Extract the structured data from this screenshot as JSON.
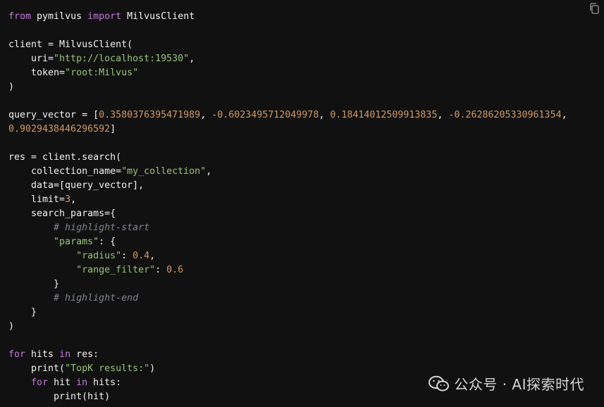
{
  "colors": {
    "background": "#111111",
    "text": "#f2f2f2",
    "keyword": "#c678dd",
    "string": "#98c379",
    "number": "#d19a66",
    "comment": "#7f848e"
  },
  "toolbar": {
    "copy_icon": "copy-icon"
  },
  "watermark": {
    "icon": "wechat-icon",
    "text": "公众号 · AI探索时代"
  },
  "code": {
    "language": "python",
    "lines": [
      [
        {
          "t": "kw",
          "v": "from"
        },
        {
          "t": "plain",
          "v": " pymilvus "
        },
        {
          "t": "kw",
          "v": "import"
        },
        {
          "t": "plain",
          "v": " MilvusClient"
        }
      ],
      [],
      [
        {
          "t": "plain",
          "v": "client = MilvusClient("
        }
      ],
      [
        {
          "t": "plain",
          "v": "    uri="
        },
        {
          "t": "str",
          "v": "\"http://localhost:19530\""
        },
        {
          "t": "plain",
          "v": ","
        }
      ],
      [
        {
          "t": "plain",
          "v": "    token="
        },
        {
          "t": "str",
          "v": "\"root:Milvus\""
        }
      ],
      [
        {
          "t": "plain",
          "v": ")"
        }
      ],
      [],
      [
        {
          "t": "plain",
          "v": "query_vector = ["
        },
        {
          "t": "num",
          "v": "0.3580376395471989"
        },
        {
          "t": "plain",
          "v": ", "
        },
        {
          "t": "num",
          "v": "-0.6023495712049978"
        },
        {
          "t": "plain",
          "v": ", "
        },
        {
          "t": "num",
          "v": "0.18414012509913835"
        },
        {
          "t": "plain",
          "v": ", "
        },
        {
          "t": "num",
          "v": "-0.26286205330961354"
        },
        {
          "t": "plain",
          "v": ","
        }
      ],
      [
        {
          "t": "num",
          "v": "0.9029438446296592"
        },
        {
          "t": "plain",
          "v": "]"
        }
      ],
      [],
      [
        {
          "t": "plain",
          "v": "res = client.search("
        }
      ],
      [
        {
          "t": "plain",
          "v": "    collection_name="
        },
        {
          "t": "str",
          "v": "\"my_collection\""
        },
        {
          "t": "plain",
          "v": ","
        }
      ],
      [
        {
          "t": "plain",
          "v": "    data=[query_vector],"
        }
      ],
      [
        {
          "t": "plain",
          "v": "    limit="
        },
        {
          "t": "num",
          "v": "3"
        },
        {
          "t": "plain",
          "v": ","
        }
      ],
      [
        {
          "t": "plain",
          "v": "    search_params={"
        }
      ],
      [
        {
          "t": "cmt",
          "v": "        # highlight-start"
        }
      ],
      [
        {
          "t": "plain",
          "v": "        "
        },
        {
          "t": "str",
          "v": "\"params\""
        },
        {
          "t": "plain",
          "v": ": {"
        }
      ],
      [
        {
          "t": "plain",
          "v": "            "
        },
        {
          "t": "str",
          "v": "\"radius\""
        },
        {
          "t": "plain",
          "v": ": "
        },
        {
          "t": "num",
          "v": "0.4"
        },
        {
          "t": "plain",
          "v": ","
        }
      ],
      [
        {
          "t": "plain",
          "v": "            "
        },
        {
          "t": "str",
          "v": "\"range_filter\""
        },
        {
          "t": "plain",
          "v": ": "
        },
        {
          "t": "num",
          "v": "0.6"
        }
      ],
      [
        {
          "t": "plain",
          "v": "        }"
        }
      ],
      [
        {
          "t": "cmt",
          "v": "        # highlight-end"
        }
      ],
      [
        {
          "t": "plain",
          "v": "    }"
        }
      ],
      [
        {
          "t": "plain",
          "v": ")"
        }
      ],
      [],
      [
        {
          "t": "kw",
          "v": "for"
        },
        {
          "t": "plain",
          "v": " hits "
        },
        {
          "t": "kw",
          "v": "in"
        },
        {
          "t": "plain",
          "v": " res:"
        }
      ],
      [
        {
          "t": "plain",
          "v": "    print("
        },
        {
          "t": "str",
          "v": "\"TopK results:\""
        },
        {
          "t": "plain",
          "v": ")"
        }
      ],
      [
        {
          "t": "plain",
          "v": "    "
        },
        {
          "t": "kw",
          "v": "for"
        },
        {
          "t": "plain",
          "v": " hit "
        },
        {
          "t": "kw",
          "v": "in"
        },
        {
          "t": "plain",
          "v": " hits:"
        }
      ],
      [
        {
          "t": "plain",
          "v": "        print(hit)"
        }
      ]
    ]
  }
}
